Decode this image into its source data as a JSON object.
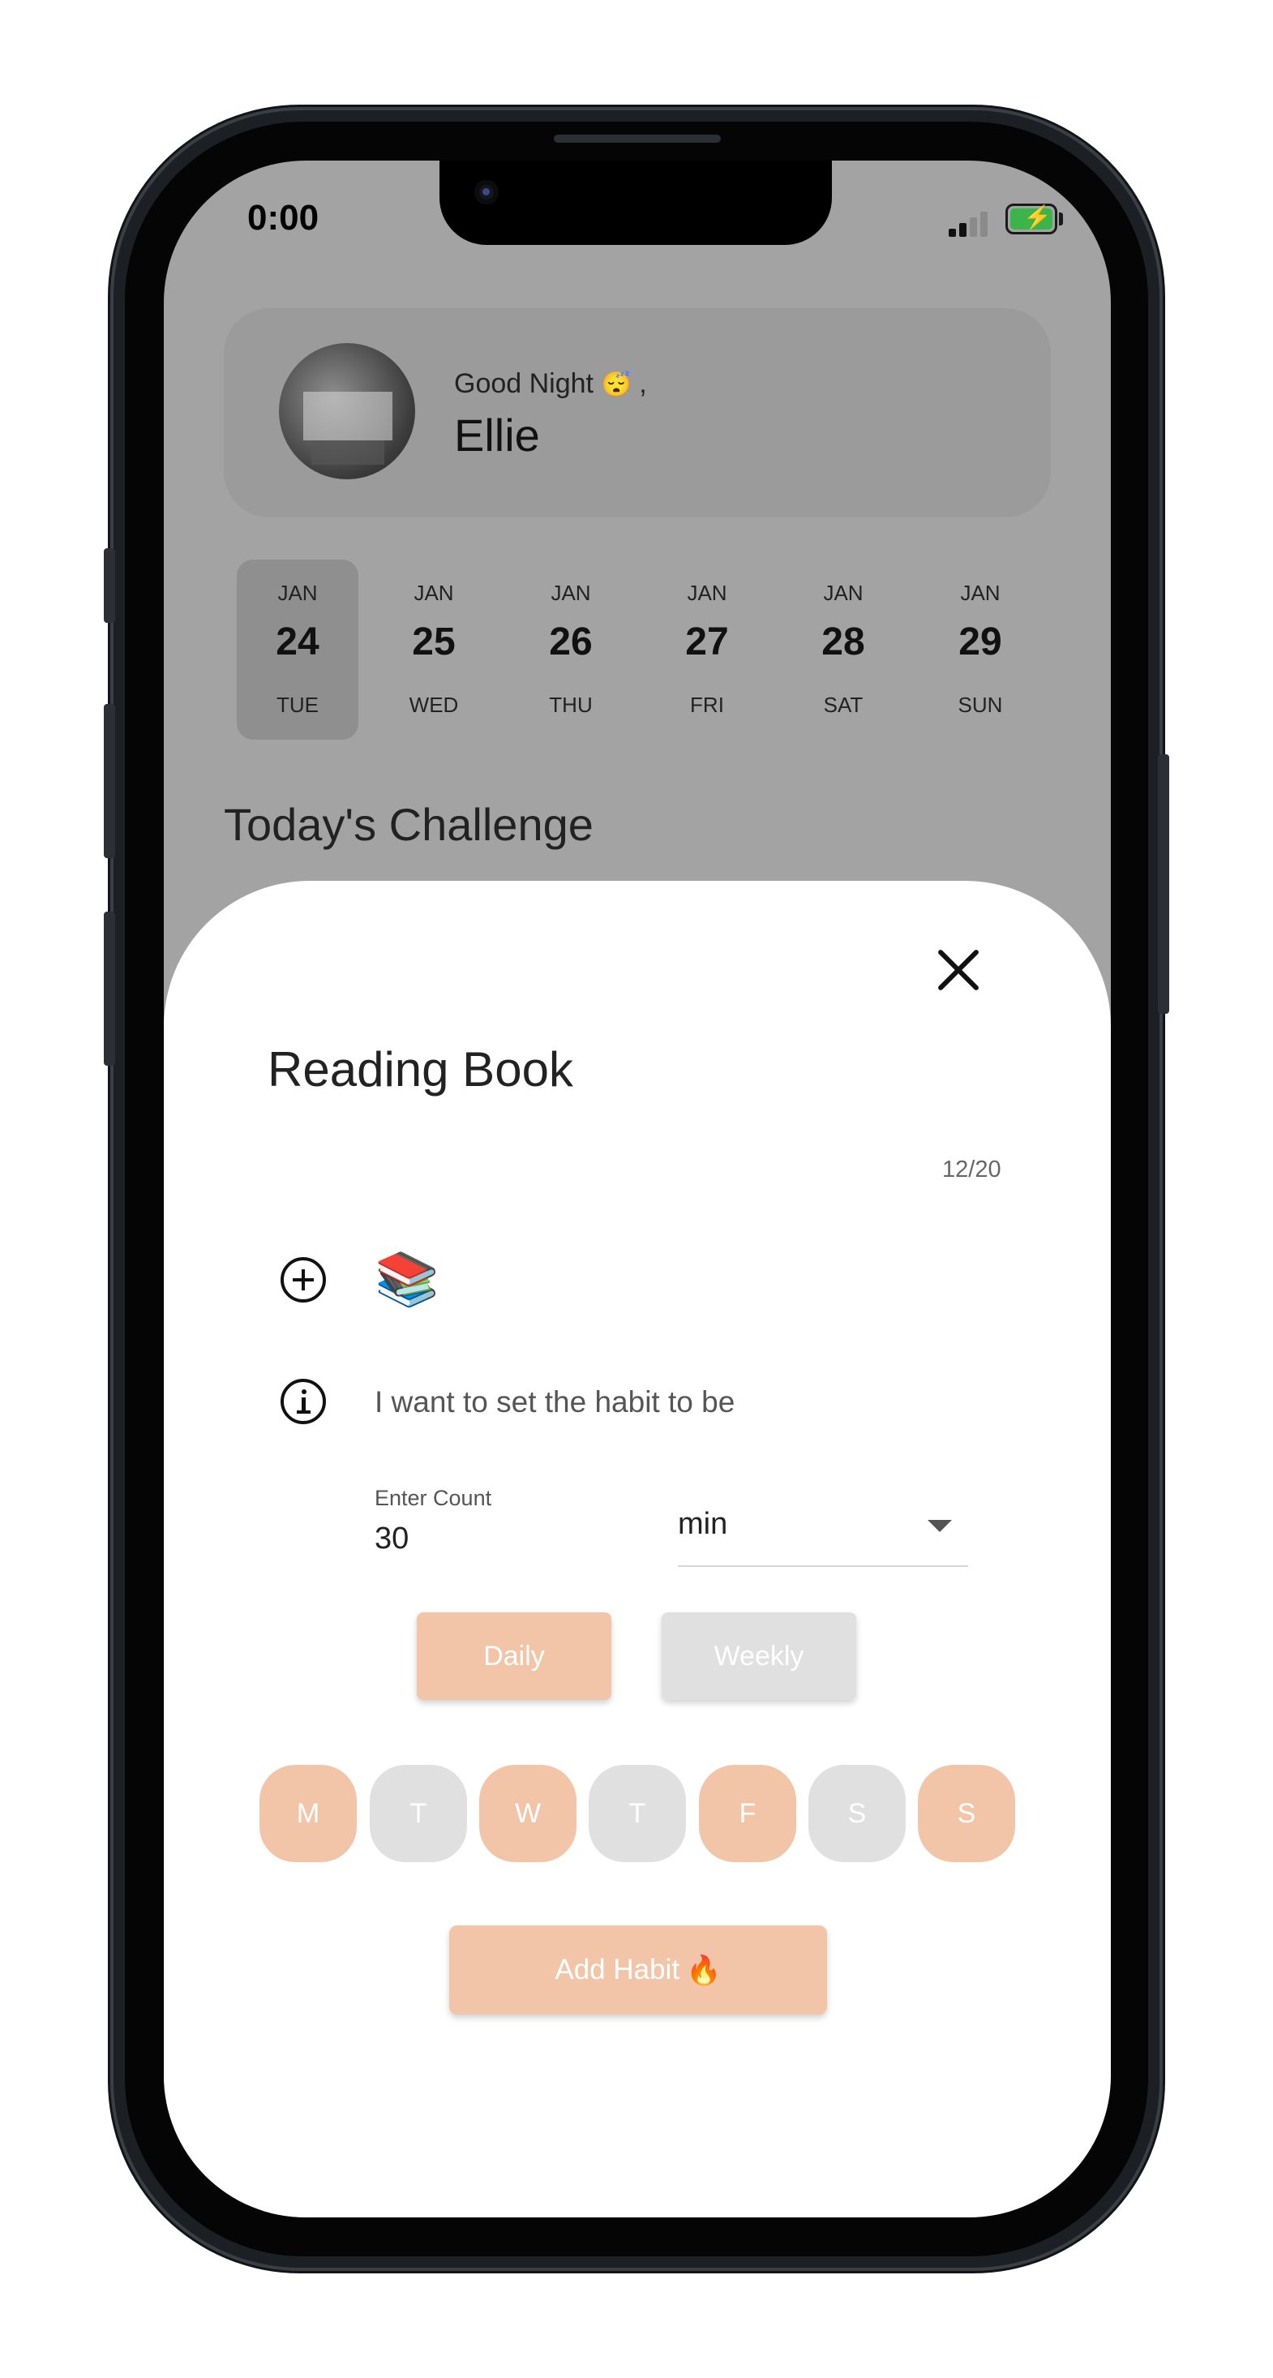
{
  "status_bar": {
    "time": "0:00"
  },
  "greeting": {
    "text": "Good Night",
    "emoji": "😴",
    "suffix": " ,",
    "name": "Ellie"
  },
  "dates": [
    {
      "month": "JAN",
      "day": "24",
      "dow": "TUE",
      "selected": true
    },
    {
      "month": "JAN",
      "day": "25",
      "dow": "WED",
      "selected": false
    },
    {
      "month": "JAN",
      "day": "26",
      "dow": "THU",
      "selected": false
    },
    {
      "month": "JAN",
      "day": "27",
      "dow": "FRI",
      "selected": false
    },
    {
      "month": "JAN",
      "day": "28",
      "dow": "SAT",
      "selected": false
    },
    {
      "month": "JAN",
      "day": "29",
      "dow": "SUN",
      "selected": false
    }
  ],
  "section_title": "Today's Challenge",
  "sheet": {
    "habit_name": "Reading Book",
    "char_count": "12/20",
    "habit_emoji": "📚",
    "habit_sentence": "I want to set the habit to be",
    "count_label": "Enter Count",
    "count_value": "30",
    "unit_value": "min",
    "frequency": [
      {
        "label": "Daily",
        "selected": true
      },
      {
        "label": "Weekly",
        "selected": false
      }
    ],
    "days": [
      {
        "label": "M",
        "selected": true
      },
      {
        "label": "T",
        "selected": false
      },
      {
        "label": "W",
        "selected": true
      },
      {
        "label": "T",
        "selected": false
      },
      {
        "label": "F",
        "selected": true
      },
      {
        "label": "S",
        "selected": false
      },
      {
        "label": "S",
        "selected": true
      }
    ],
    "add_button_label": "Add Habit",
    "add_button_emoji": "🔥"
  },
  "colors": {
    "accent": "#f2c5a9",
    "inactive": "#e0e0e0",
    "screen_dim": "#a3a3a3"
  }
}
